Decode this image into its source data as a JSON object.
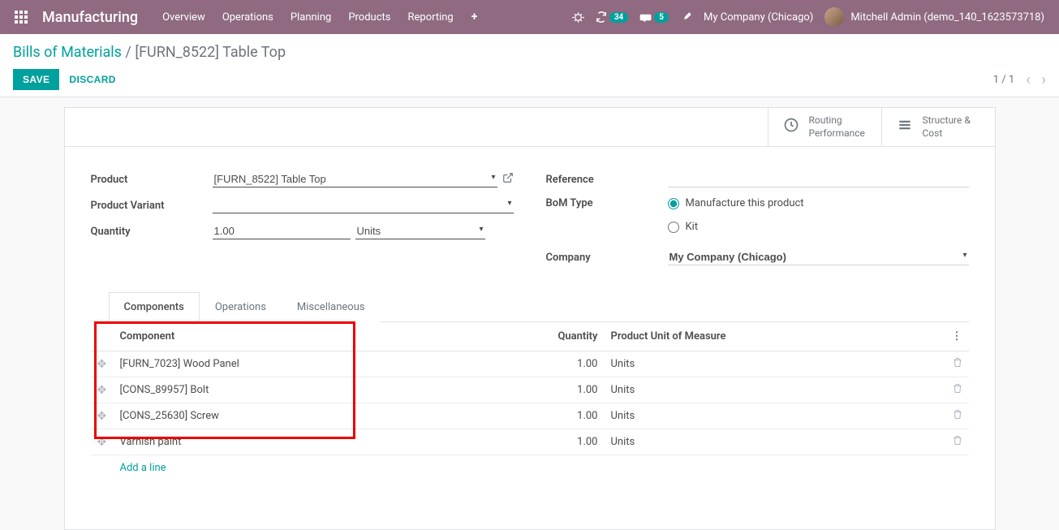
{
  "topbar": {
    "app_title": "Manufacturing",
    "menu": [
      "Overview",
      "Operations",
      "Planning",
      "Products",
      "Reporting"
    ],
    "badge_refresh": "34",
    "badge_msg": "5",
    "company": "My Company (Chicago)",
    "user": "Mitchell Admin (demo_140_1623573718)"
  },
  "breadcrumbs": {
    "root": "Bills of Materials",
    "sep": " / ",
    "current": "[FURN_8522] Table Top"
  },
  "buttons": {
    "save": "SAVE",
    "discard": "DISCARD"
  },
  "pager": {
    "text": "1 / 1"
  },
  "statboxes": [
    {
      "line1": "Routing",
      "line2": "Performance"
    },
    {
      "line1": "Structure &",
      "line2": "Cost"
    }
  ],
  "form": {
    "labels": {
      "product": "Product",
      "variant": "Product Variant",
      "quantity": "Quantity",
      "reference": "Reference",
      "bom_type": "BoM Type",
      "company": "Company"
    },
    "values": {
      "product": "[FURN_8522] Table Top",
      "variant": "",
      "quantity": "1.00",
      "quantity_unit": "Units",
      "reference": "",
      "company": "My Company (Chicago)"
    },
    "bom_options": {
      "manufacture": "Manufacture this product",
      "kit": "Kit"
    }
  },
  "tabs": [
    "Components",
    "Operations",
    "Miscellaneous"
  ],
  "components": {
    "headers": {
      "component": "Component",
      "quantity": "Quantity",
      "uom": "Product Unit of Measure"
    },
    "rows": [
      {
        "name": "[FURN_7023] Wood Panel",
        "qty": "1.00",
        "uom": "Units"
      },
      {
        "name": "[CONS_89957] Bolt",
        "qty": "1.00",
        "uom": "Units"
      },
      {
        "name": "[CONS_25630] Screw",
        "qty": "1.00",
        "uom": "Units"
      },
      {
        "name": "Varnish paint",
        "qty": "1.00",
        "uom": "Units"
      }
    ],
    "add_line": "Add a line"
  }
}
